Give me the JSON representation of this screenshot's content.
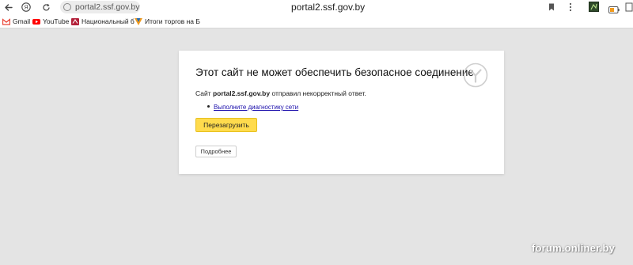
{
  "browser": {
    "url_chip": "portal2.ssf.gov.by",
    "title_domain": "portal2.ssf.gov.by",
    "icons": {
      "back": "arrow-left-icon",
      "yandex": "yandex-icon",
      "bookmark": "bookmark-icon",
      "menu": "more-vertical-icon",
      "battery": "battery-icon"
    }
  },
  "bookmarks": [
    {
      "label": "Gmail",
      "icon": "gmail-icon",
      "color": "#ea4335"
    },
    {
      "label": "YouTube",
      "icon": "youtube-icon",
      "color": "#ff0000"
    },
    {
      "label": "Национальный б",
      "icon": "bank-icon",
      "color": "#b3213a"
    },
    {
      "label": "Итоги торгов на Б",
      "icon": "chart-icon",
      "color": "#f29b1d"
    }
  ],
  "error": {
    "title": "Этот сайт не может обеспечить безопасное соединение.",
    "message_prefix": "Сайт ",
    "message_domain": "portal2.ssf.gov.by",
    "message_suffix": " отправил некорректный ответ.",
    "suggestion_link": "Выполните диагностику сети",
    "reload_label": "Перезагрузить",
    "details_label": "Подробнее"
  },
  "colors": {
    "background": "#e4e4e4",
    "reload_button": "#ffdb4d",
    "link": "#1a0dab"
  },
  "watermark": "forum.onliner.by"
}
